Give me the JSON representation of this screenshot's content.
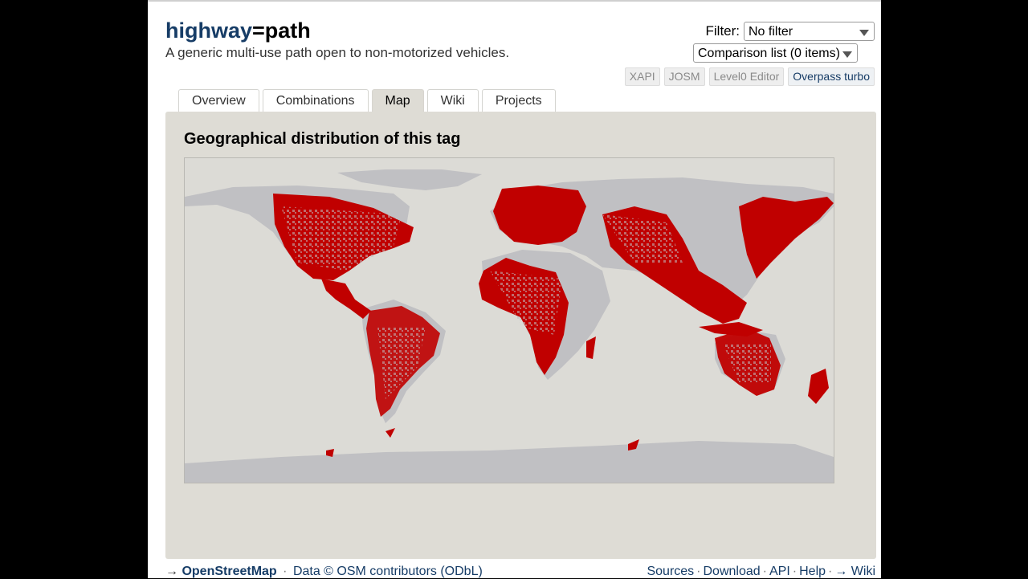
{
  "header": {
    "title_key": "highway",
    "title_rest": "=path",
    "subtitle": "A generic multi-use path open to non-motorized vehicles."
  },
  "filter": {
    "label": "Filter:",
    "selected": "No filter"
  },
  "comparison": {
    "selected": "Comparison list (0 items)"
  },
  "tools": [
    "XAPI",
    "JOSM",
    "Level0 Editor",
    "Overpass turbo"
  ],
  "tabs": [
    {
      "label": "Overview"
    },
    {
      "label": "Combinations"
    },
    {
      "label": "Map",
      "active": true
    },
    {
      "label": "Wiki"
    },
    {
      "label": "Projects"
    }
  ],
  "panel": {
    "heading": "Geographical distribution of this tag"
  },
  "map": {
    "land_color": "#c0c0c3",
    "usage_color": "#c00000",
    "ocean_color": "#dcdbd6"
  },
  "footer": {
    "arrow": "→",
    "osm_link": "OpenStreetMap",
    "data_credit": "Data © OSM contributors (ODbL)",
    "links": [
      "Sources",
      "Download",
      "API",
      "Help"
    ],
    "wiki_link": "→ Wiki"
  }
}
